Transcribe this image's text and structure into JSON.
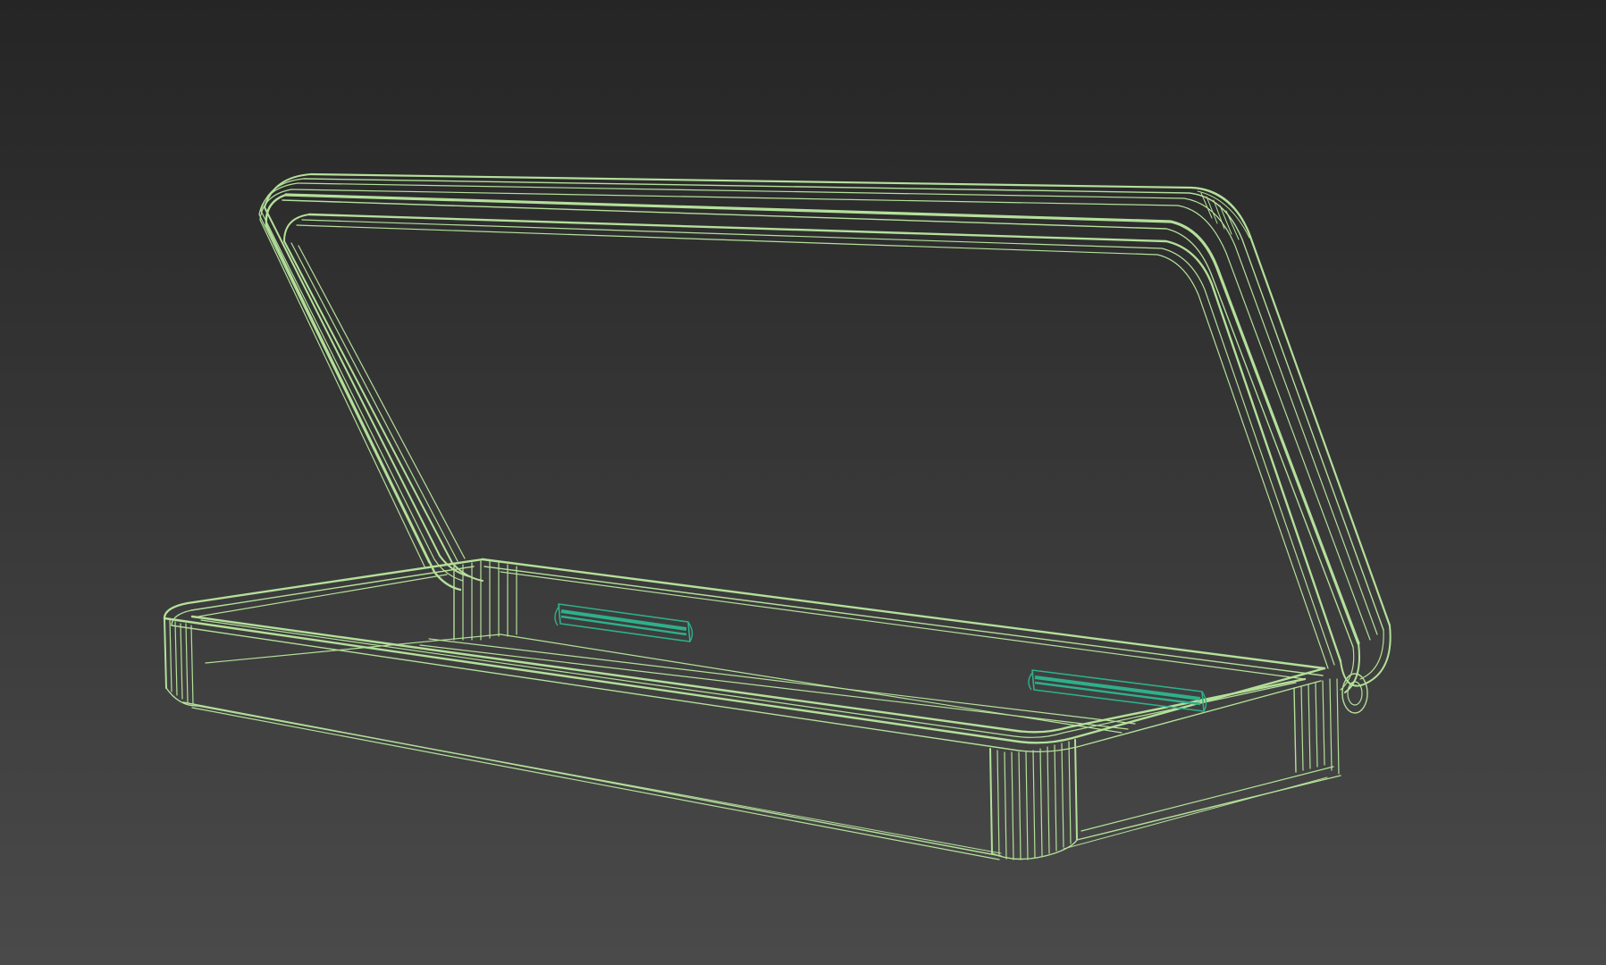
{
  "viewport": {
    "projection": "perspective",
    "shading": "wireframe",
    "background": {
      "top": "#252525",
      "bottom": "#4a4a4a"
    }
  },
  "scene": {
    "objects": [
      {
        "id": "case-lid",
        "kind": "mesh",
        "wire_color": "#b4e09a"
      },
      {
        "id": "case-base",
        "kind": "mesh",
        "wire_color": "#b4e09a"
      },
      {
        "id": "hinge-left",
        "kind": "mesh",
        "wire_color": "#2eb08a"
      },
      {
        "id": "hinge-right",
        "kind": "mesh",
        "wire_color": "#2eb08a"
      }
    ]
  }
}
